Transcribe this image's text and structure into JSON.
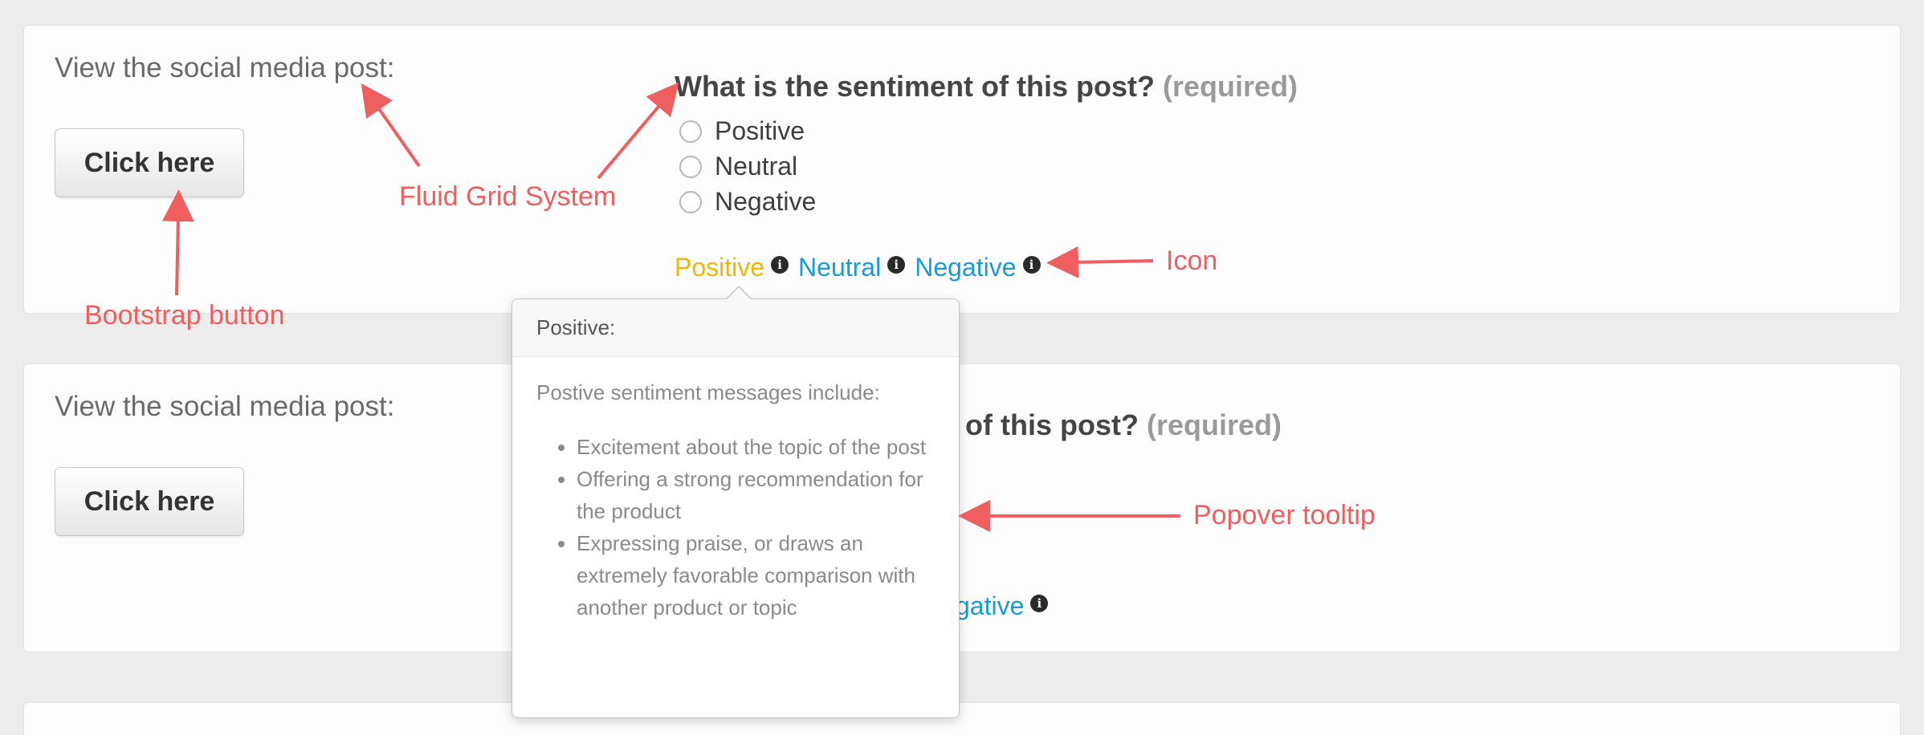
{
  "panel1": {
    "view_label": "View the social media post:",
    "button_label": "Click here",
    "question": "What is the sentiment of this post?",
    "required": "(required)",
    "options": [
      "Positive",
      "Neutral",
      "Negative"
    ],
    "legend": [
      "Positive",
      "Neutral",
      "Negative"
    ]
  },
  "panel2": {
    "view_label": "View the social media post:",
    "button_label": "Click here",
    "question_visible": "t of this post?",
    "required": "(required)",
    "legend_visible": "gative"
  },
  "popover": {
    "title": "Positive:",
    "intro": "Postive sentiment messages include:",
    "items": [
      "Excitement about the topic of the post",
      "Offering a strong recommendation for the product",
      "Expressing praise, or draws an extremely favorable comparison with another product or topic"
    ]
  },
  "annotations": {
    "fluid_grid": "Fluid Grid System",
    "bootstrap_button": "Bootstrap button",
    "icon": "Icon",
    "popover_tooltip": "Popover tooltip"
  },
  "colors": {
    "positive": "#f4b400",
    "link": "#1a9ad6",
    "annotation": "#ef5f5f"
  },
  "icons": {
    "info": "info-circle-icon"
  }
}
